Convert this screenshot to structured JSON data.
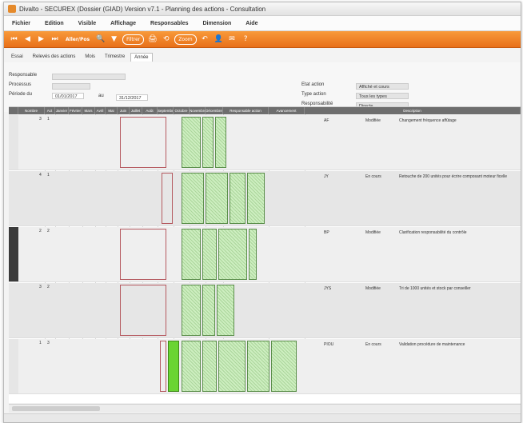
{
  "window": {
    "title": "Divalto - SECUREX (Dossier (GIAD) Version v7.1 - Planning des actions - Consultation"
  },
  "menu": [
    "Fichier",
    "Edition",
    "Visible",
    "Affichage",
    "Responsables",
    "Dimension",
    "Aide"
  ],
  "toolbar": {
    "first": "⏮",
    "prev": "◀",
    "next": "▶",
    "last": "⏭",
    "goto_label": "Aller/Pos",
    "search": "🔍",
    "filter": "▼",
    "pill_label": "Filtrer",
    "print": "🖨",
    "refresh": "⟲",
    "zoom": "Zoom",
    "undo": "↶",
    "user": "👤",
    "mail": "✉",
    "help": "?"
  },
  "tabs": [
    "Essai",
    "Relevés des actions",
    "Mois",
    "Trimestre",
    "Année"
  ],
  "filters": {
    "responsable_label": "Responsable",
    "processus_label": "Processus",
    "periode_label": "Période du",
    "date_from": "01/01/2017",
    "au_label": "au",
    "date_to": "31/12/2017",
    "etat_label": "Etat action",
    "etat_value": "Affiché et cours",
    "type_label": "Type action",
    "type_value": "Tous les types",
    "resp2_label": "Responsabilité",
    "resp2_value": "Directe"
  },
  "grid": {
    "columns": [
      "",
      "Nombre",
      "Act",
      "Janvier",
      "Février",
      "Mars",
      "Avril",
      "Mai",
      "Juin",
      "Juillet",
      "Août",
      "Septembre",
      "Octobre",
      "Novembre",
      "Décembre",
      "Responsable action",
      "Avancement",
      "Description"
    ],
    "rows": [
      {
        "n1": "3",
        "n2": "1",
        "resp": "AF",
        "status": "Modifiée",
        "desc": "Changement fréquence affûtage"
      },
      {
        "n1": "4",
        "n2": "1",
        "resp": "JY",
        "status": "En cours",
        "desc": "Retouche de 200 unités pour écrire composant moteur ficelle"
      },
      {
        "n1": "2",
        "n2": "2",
        "resp": "BP",
        "status": "Modifiée",
        "desc": "Clarification responsabilité du contrôle"
      },
      {
        "n1": "3",
        "n2": "2",
        "resp": "JYS",
        "status": "Modifiée",
        "desc": "Tri de 1000 unités et stock par conseiller"
      },
      {
        "n1": "1",
        "n2": "3",
        "resp": "PIOU",
        "status": "En cours",
        "desc": "Validation procédure de maintenance"
      }
    ]
  },
  "colors": {
    "toolbar": "#ef7f25",
    "planned_red": "#f5c6c8",
    "done_green": "#cdeec0",
    "current_green": "#6ad433",
    "header": "#6e6e6e"
  }
}
